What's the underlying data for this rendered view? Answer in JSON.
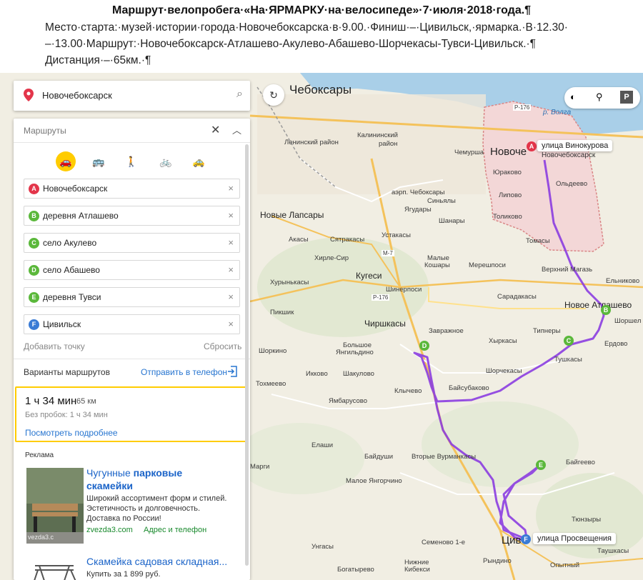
{
  "document": {
    "title": "Маршрут·велопробега·«На·ЯРМАРКУ·на·велосипеде»·7·июля·2018·года.¶",
    "line1": "Место·старта:·музей·истории·города·Новочебоксарска·в·9.00.·Финиш·–·Цивильск,·ярмарка.·В·12.30·",
    "line2": "–·13.00·Маршрут:·Новочебоксарск-Атлашево-Акулево-Абашево-Шорчекасы-Тувси-Цивильск.·¶",
    "line3": "Дистанция·–·65км.·¶"
  },
  "search": {
    "value": "Новочебоксарск",
    "icon": "search-icon"
  },
  "routes_panel": {
    "header": "Маршруты",
    "modes": [
      {
        "name": "car",
        "icon": "car-icon",
        "active": true
      },
      {
        "name": "bus",
        "icon": "bus-icon",
        "active": false
      },
      {
        "name": "walk",
        "icon": "walk-icon",
        "active": false
      },
      {
        "name": "bike",
        "icon": "bike-icon",
        "active": false
      },
      {
        "name": "taxi",
        "icon": "taxi-icon",
        "active": false
      }
    ],
    "waypoints": [
      {
        "letter": "A",
        "label": "Новочебоксарск",
        "color": "#e3354a"
      },
      {
        "letter": "B",
        "label": "деревня Атлашево",
        "color": "#5bb83b"
      },
      {
        "letter": "C",
        "label": "село Акулево",
        "color": "#5bb83b"
      },
      {
        "letter": "D",
        "label": "село Абашево",
        "color": "#5bb83b"
      },
      {
        "letter": "E",
        "label": "деревня Тувси",
        "color": "#5bb83b"
      },
      {
        "letter": "F",
        "label": "Цивильск",
        "color": "#3a7bd5"
      }
    ],
    "add_point": "Добавить точку",
    "reset": "Сбросить",
    "variants": "Варианты маршрутов",
    "send": "Отправить в телефон",
    "route": {
      "time": "1 ч 34 мин",
      "distance": "65 км",
      "no_traffic": "Без пробок: 1 ч 34 мин",
      "details": "Посмотреть подробнее"
    },
    "ads_label": "Реклама",
    "ad1": {
      "title_plain": "Чугунные ",
      "title_bold": "парковые",
      "title_line2": "скамейки",
      "text1": "Широкий ассортимент форм и стилей.",
      "text2": "Эстетичность и долговечность.",
      "text3": "Доставка по России!",
      "host": "zvezda3.com",
      "contact": "Адрес и телефон",
      "watermark": "vezda3.c"
    },
    "ad2": {
      "title": "Скамейка садовая складная...",
      "price": "Купить за 1 899 руб."
    }
  },
  "map": {
    "pins": {
      "A": "улица Винокурова",
      "A_sub": "Новочебоксарск",
      "F": "улица Просвещения"
    },
    "labels": {
      "cheboksary": "Чебоксары",
      "novoch": "Новоче",
      "kalininsky": "Калининский",
      "kalininsky2": "район",
      "leninsky": "Ленинский район",
      "chemurshi": "Чемурша",
      "yurakovo": "Юраково",
      "lipovo": "Липово",
      "oldeevo": "Ольдеево",
      "tolikovo": "Толиково",
      "tomasy": "Томасы",
      "airport": "аэрп. Чебоксары",
      "sinyaly": "Синьялы",
      "yagudary": "Ягудары",
      "shanary": "Шанары",
      "novye_lapsary": "Новые Лапсары",
      "akasy": "Акасы",
      "syatrakasy": "Сятракасы",
      "ustakasy": "Устакасы",
      "hirle_sir": "Хирле-Сир",
      "kugesi": "Кугеси",
      "malye_kosary1": "Малые",
      "malye_kosary2": "Кошары",
      "mereshposi": "Мерешпоси",
      "verkhny_magaz": "Верхний Магазь",
      "elnikovo": "Ельниково",
      "hurynkasy": "Хурынькасы",
      "shinerposi": "Шинерпоси",
      "saradakasy": "Сарадакасы",
      "novoe_atl": "Новое Атлашево",
      "shorsh": "Шоршел",
      "piknik": "Пикшик",
      "chirshkasy": "Чиршкасы",
      "zavrazhnoe": "Завражное",
      "tipnery": "Типнеры",
      "erdovo": "Ердово",
      "shorkino": "Шоркино",
      "bolshoe_yanyl1": "Большое",
      "bolshoe_yanyl2": "Янгильдино",
      "khyrkasy": "Хыркасы",
      "tushkasy": "Тушкасы",
      "ikkovo": "Икково",
      "shakulovo": "Шакулово",
      "shorchekasy": "Шорчекасы",
      "tokhmeevo": "Тохмеево",
      "klychevo": "Клычево",
      "baysubakovo": "Байсубаково",
      "yambarusovo": "Ямбарусово",
      "elashi": "Елаши",
      "baydushi": "Байдуши",
      "vtorye_vurmankasy": "Вторые Вурманкасы",
      "margi": "Марги",
      "maloe_yangorchino": "Малое Янгорчино",
      "baygeevo": "Байгеево",
      "tuzhary": "Тюнзыры",
      "ungasy": "Унгасы",
      "semenovo": "Семеново 1-е",
      "tsiv": "Цив",
      "taushkasy": "Таушкасы",
      "opytny": "Опытный",
      "ryndino": "Рындино",
      "bogatyrevo": "Богатырево",
      "nizhnie_kibeksi1": "Нижние",
      "nizhnie_kibeksi2": "Кибекси",
      "volga": "р. Волга",
      "r176a": "Р-176",
      "r176b": "Р-176",
      "m7": "М-7"
    }
  }
}
